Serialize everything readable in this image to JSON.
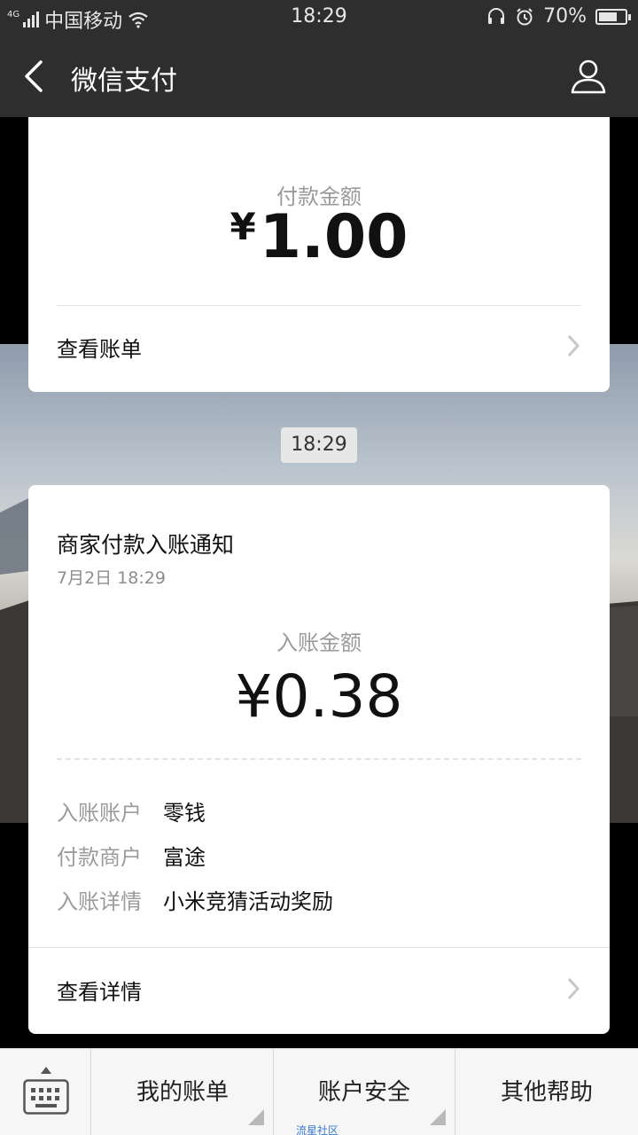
{
  "status_bar": {
    "network_tag": "4G",
    "carrier": "中国移动",
    "time": "18:29",
    "battery": "70%",
    "battery_level": 0.7,
    "icons": [
      "signal-icon",
      "wifi-icon",
      "headset-icon",
      "alarm-icon",
      "battery-icon"
    ]
  },
  "header": {
    "title": "微信支付",
    "icons": [
      "back-arrow-icon",
      "person-icon"
    ]
  },
  "payment_card": {
    "label": "付款金额",
    "currency": "¥",
    "amount": "1.00",
    "link": "查看账单"
  },
  "time_chip": "18:29",
  "notice_card": {
    "title": "商家付款入账通知",
    "date": "7月2日  18:29",
    "label": "入账金额",
    "amount": "¥0.38",
    "details": [
      {
        "key": "入账账户",
        "value": "零钱"
      },
      {
        "key": "付款商户",
        "value": "富途"
      },
      {
        "key": "入账详情",
        "value": "小米竞猜活动奖励"
      }
    ],
    "link": "查看详情"
  },
  "bottom_menu": {
    "items": [
      "我的账单",
      "账户安全",
      "其他帮助"
    ],
    "icons": [
      "keyboard-icon"
    ]
  },
  "watermark": "流星社区"
}
